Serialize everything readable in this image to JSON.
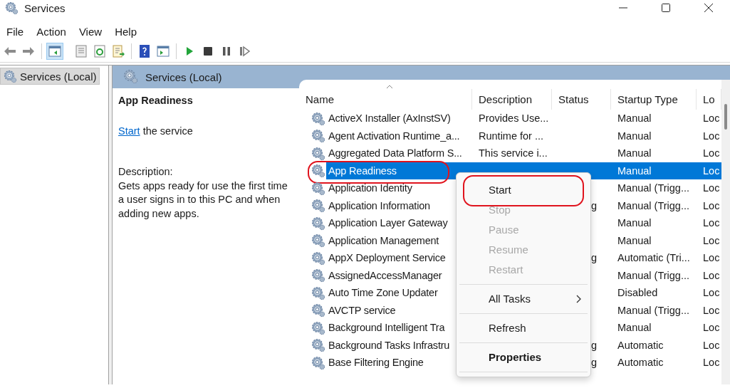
{
  "window": {
    "title": "Services"
  },
  "menu_bar": [
    "File",
    "Action",
    "View",
    "Help"
  ],
  "toolbar": {
    "console_tree_pressed": true
  },
  "tree": {
    "items": [
      {
        "label": "Services (Local)",
        "selected": true
      }
    ]
  },
  "pane_header": "Services (Local)",
  "details": {
    "title": "App Readiness",
    "action_link": "Start",
    "action_text": "the service",
    "description_label": "Description:",
    "description": "Gets apps ready for use the first time a user signs in to this PC and when adding new apps."
  },
  "table": {
    "columns": [
      "Name",
      "Description",
      "Status",
      "Startup Type",
      "Lo"
    ],
    "rows": [
      {
        "name": "ActiveX Installer (AxInstSV)",
        "description": "Provides Use...",
        "startup_type": "Manual",
        "log_on_as": "Loc",
        "selected": false,
        "highlight": false
      },
      {
        "name": "Agent Activation Runtime_a...",
        "description": "Runtime for ...",
        "startup_type": "Manual",
        "log_on_as": "Loc",
        "selected": false,
        "highlight": false
      },
      {
        "name": "Aggregated Data Platform S...",
        "description": "This service i...",
        "startup_type": "Manual",
        "log_on_as": "Loc",
        "selected": false,
        "highlight": false
      },
      {
        "name": "App Readiness",
        "startup_type": "Manual",
        "log_on_as": "Loc",
        "selected": true,
        "highlight": true
      },
      {
        "name": "Application Identity",
        "startup_type": "Manual (Trigg...",
        "log_on_as": "Loc",
        "selected": false,
        "highlight": false
      },
      {
        "name": "Application Information",
        "status": "g",
        "startup_type": "Manual (Trigg...",
        "log_on_as": "Loc",
        "selected": false,
        "highlight": false
      },
      {
        "name": "Application Layer Gateway",
        "startup_type": "Manual",
        "log_on_as": "Loc",
        "selected": false,
        "highlight": false
      },
      {
        "name": "Application Management",
        "startup_type": "Manual",
        "log_on_as": "Loc",
        "selected": false,
        "highlight": false
      },
      {
        "name": "AppX Deployment Service",
        "status": "g",
        "startup_type": "Automatic (Tri...",
        "log_on_as": "Loc",
        "selected": false,
        "highlight": false
      },
      {
        "name": "AssignedAccessManager",
        "startup_type": "Manual (Trigg...",
        "log_on_as": "Loc",
        "selected": false,
        "highlight": false
      },
      {
        "name": "Auto Time Zone Updater",
        "startup_type": "Disabled",
        "log_on_as": "Loc",
        "selected": false,
        "highlight": false
      },
      {
        "name": "AVCTP service",
        "startup_type": "Manual (Trigg...",
        "log_on_as": "Loc",
        "selected": false,
        "highlight": false
      },
      {
        "name": "Background Intelligent Tra",
        "startup_type": "Manual",
        "log_on_as": "Loc",
        "selected": false,
        "highlight": false
      },
      {
        "name": "Background Tasks Infrastru",
        "status": "g",
        "startup_type": "Automatic",
        "log_on_as": "Loc",
        "selected": false,
        "highlight": false
      },
      {
        "name": "Base Filtering Engine",
        "status": "g",
        "startup_type": "Automatic",
        "log_on_as": "Loc",
        "selected": false,
        "highlight": false
      }
    ]
  },
  "context_menu": [
    {
      "kind": "item",
      "label": "Start",
      "disabled": false,
      "highlight": true
    },
    {
      "kind": "item",
      "label": "Stop",
      "disabled": true,
      "highlight": false
    },
    {
      "kind": "item",
      "label": "Pause",
      "disabled": true,
      "highlight": false
    },
    {
      "kind": "item",
      "label": "Resume",
      "disabled": true,
      "highlight": false
    },
    {
      "kind": "item",
      "label": "Restart",
      "disabled": true,
      "highlight": false
    },
    {
      "kind": "separator"
    },
    {
      "kind": "submenu",
      "label": "All Tasks",
      "disabled": false,
      "highlight": false
    },
    {
      "kind": "separator"
    },
    {
      "kind": "item",
      "label": "Refresh",
      "disabled": false,
      "highlight": false
    },
    {
      "kind": "separator"
    },
    {
      "kind": "default",
      "label": "Properties",
      "disabled": false,
      "highlight": false
    },
    {
      "kind": "separator"
    }
  ]
}
